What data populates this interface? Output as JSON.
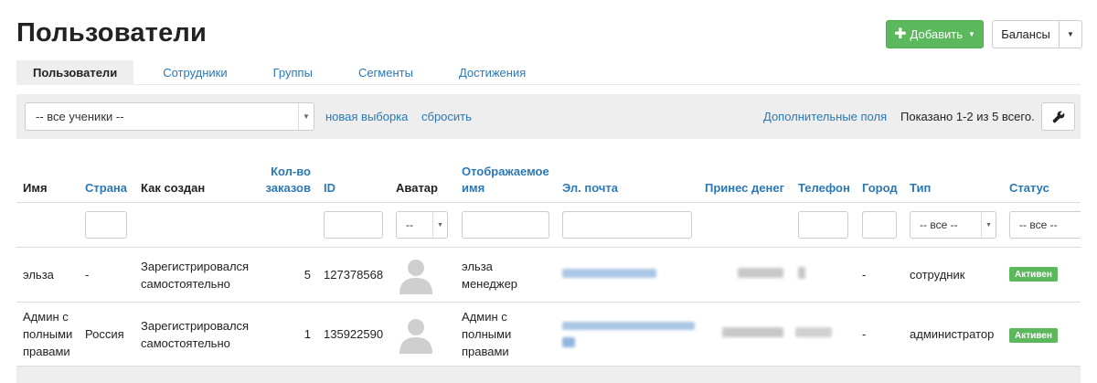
{
  "page": {
    "title": "Пользователи"
  },
  "toolbar": {
    "add_label": "Добавить",
    "balances_label": "Балансы"
  },
  "tabs": [
    {
      "label": "Пользователи",
      "active": true
    },
    {
      "label": "Сотрудники"
    },
    {
      "label": "Группы"
    },
    {
      "label": "Сегменты"
    },
    {
      "label": "Достижения"
    }
  ],
  "filter": {
    "students_select": "-- все ученики --",
    "new_selection": "новая выборка",
    "reset": "сбросить",
    "extra_fields": "Дополнительные поля",
    "shown": "Показано 1-2 из 5 всего."
  },
  "columns": {
    "name": "Имя",
    "country": "Страна",
    "created": "Как создан",
    "orders_1": "Кол-во",
    "orders_2": "заказов",
    "id": "ID",
    "avatar": "Аватар",
    "display_1": "Отображаемое",
    "display_2": "имя",
    "email": "Эл. почта",
    "money": "Принес денег",
    "phone": "Телефон",
    "city": "Город",
    "type": "Тип",
    "status": "Статус"
  },
  "column_filters": {
    "avatar_select": "--",
    "type_select": "-- все --",
    "status_select": "-- все --"
  },
  "rows": [
    {
      "name_lines": [
        "эльза"
      ],
      "country": "-",
      "created_lines": [
        "Зарегистрировался",
        "самостоятельно"
      ],
      "orders": "5",
      "id": "127378568",
      "display_lines": [
        "эльза",
        "менеджер"
      ],
      "city": "-",
      "type": "сотрудник",
      "status": "Активен"
    },
    {
      "name_lines": [
        "Админ с",
        "полными",
        "правами"
      ],
      "country": "Россия",
      "created_lines": [
        "Зарегистрировался",
        "самостоятельно"
      ],
      "orders": "1",
      "id": "135922590",
      "display_lines": [
        "Админ с",
        "полными",
        "правами"
      ],
      "city": "-",
      "type": "администратор",
      "status": "Активен"
    }
  ],
  "colors": {
    "accent": "#2b78b6",
    "success": "#5cb85c",
    "panel": "#eeeeee"
  }
}
